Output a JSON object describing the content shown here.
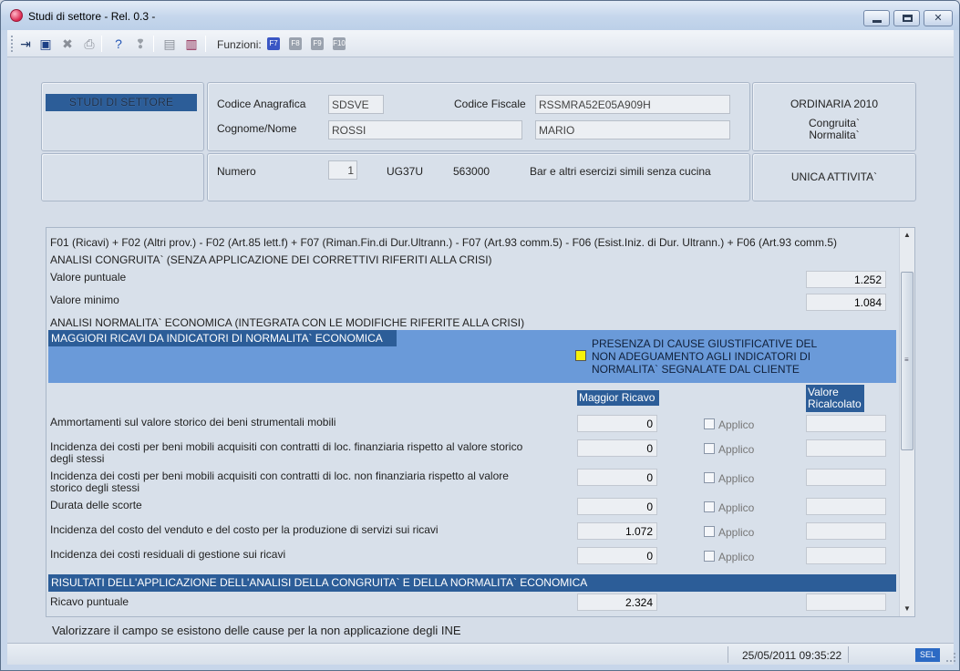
{
  "window": {
    "title": "Studi di settore - Rel. 0.3 -",
    "minimize_glyph": "",
    "close_glyph": "✕"
  },
  "toolbar": {
    "functions_label": "Funzioni:",
    "fkeys": [
      "F7",
      "F8",
      "F9",
      "F10"
    ],
    "icons": [
      "exit-icon",
      "save-icon",
      "delete-icon",
      "print-icon",
      "help-icon",
      "info-icon",
      "document-icon",
      "books-icon"
    ]
  },
  "header": {
    "badge": "STUDI DI SETTORE",
    "codice_anagrafica_label": "Codice Anagrafica",
    "codice_anagrafica_value": "SDSVE",
    "codice_fiscale_label": "Codice Fiscale",
    "codice_fiscale_value": "RSSMRA52E05A909H",
    "cognome_nome_label": "Cognome/Nome",
    "cognome_value": "ROSSI",
    "nome_value": "MARIO",
    "ordinaria": "ORDINARIA  2010",
    "congruita": "Congruita`",
    "normalita": "Normalita`",
    "numero_label": "Numero",
    "numero_value": "1",
    "studio_code": "UG37U",
    "ateco_code": "563000",
    "activity_desc": "Bar e altri esercizi simili senza cucina",
    "unica_attivita": "UNICA ATTIVITA`"
  },
  "main": {
    "formula": "F01 (Ricavi) + F02 (Altri prov.) - F02 (Art.85 lett.f) + F07 (Riman.Fin.di Dur.Ultrann.) - F07 (Art.93 comm.5) - F06 (Esist.Iniz. di Dur. Ultrann.) + F06 (Art.93 comm.5)",
    "analisi_congruita": "ANALISI CONGRUITA` (SENZA APPLICAZIONE DEI CORRETTIVI RIFERITI ALLA CRISI)",
    "valore_puntuale_label": "Valore puntuale",
    "valore_puntuale": "1.252",
    "valore_minimo_label": "Valore minimo",
    "valore_minimo": "1.084",
    "analisi_normalita": "ANALISI NORMALITA` ECONOMICA (INTEGRATA CON LE MODIFICHE RIFERITE ALLA CRISI)",
    "maggiori_ricavi_head": "MAGGIORI RICAVI DA INDICATORI DI NORMALITA` ECONOMICA",
    "cause_text": "PRESENZA DI CAUSE GIUSTIFICATIVE DEL NON ADEGUAMENTO AGLI INDICATORI DI NORMALITA` SEGNALATE DAL CLIENTE",
    "col_maggior_ricavo": "Maggior Ricavo",
    "col_valore_ricalcolato": "Valore Ricalcolato",
    "applico_label": "Applico",
    "rows": [
      {
        "label": "Ammortamenti sul valore storico dei beni strumentali mobili",
        "value": "0"
      },
      {
        "label": "Incidenza dei costi per beni mobili acquisiti con contratti di loc. finanziaria rispetto al valore storico degli stessi",
        "value": "0"
      },
      {
        "label": "Incidenza dei costi per beni mobili acquisiti con contratti di loc. non finanziaria rispetto al valore storico degli stessi",
        "value": "0"
      },
      {
        "label": "Durata delle scorte",
        "value": "0"
      },
      {
        "label": "Incidenza del costo del venduto e del costo per la produzione di servizi sui ricavi",
        "value": "1.072"
      },
      {
        "label": "Incidenza dei costi residuali di gestione sui ricavi",
        "value": "0"
      }
    ],
    "risultati_head": "RISULTATI DELL'APPLICAZIONE DELL'ANALISI DELLA CONGRUITA` E DELLA NORMALITA` ECONOMICA",
    "ricavo_puntuale_label": "Ricavo puntuale",
    "ricavo_puntuale": "2.324"
  },
  "hint": "Valorizzare il campo se esistono delle cause per la non applicazione degli INE",
  "status": {
    "datetime": "25/05/2011   09:35:22",
    "mode": "SEL"
  },
  "colors": {
    "accent_dark": "#2c5d98",
    "accent_band": "#6a9ad9",
    "yellow_flag": "#f6f20a"
  }
}
